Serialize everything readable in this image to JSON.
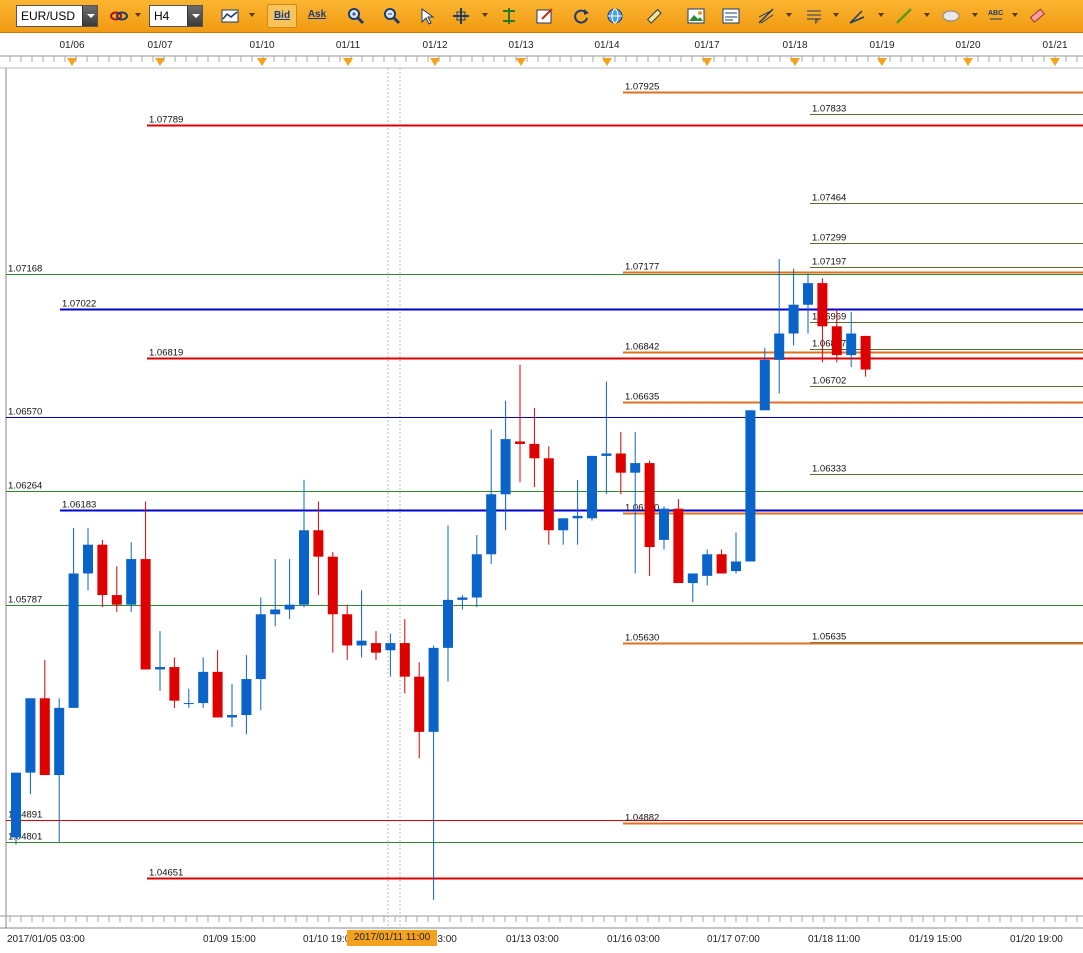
{
  "toolbar": {
    "symbol": "EUR/USD",
    "timeframe": "H4",
    "bid_label": "Bid",
    "ask_label": "Ask",
    "icons": [
      "link-icon",
      "indicator-icon",
      "zoom-in-icon",
      "zoom-out-icon",
      "cursor-icon",
      "crosshair-icon",
      "period-separator-icon",
      "edit-icon",
      "refresh-icon",
      "globe-icon",
      "ruler-icon",
      "screenshot-icon",
      "template-icon",
      "fibonacci-icon",
      "trendline-icon",
      "pen-icon",
      "line-icon",
      "ellipse-icon",
      "text-icon",
      "eraser-icon"
    ],
    "accent_color": "#f29a12"
  },
  "top_dates": [
    "01/06",
    "01/07",
    "01/10",
    "01/11",
    "01/12",
    "01/13",
    "01/14",
    "01/17",
    "01/18",
    "01/19",
    "01/20",
    "01/21"
  ],
  "bottom_dates": [
    "2017/01/05 03:00",
    "01/09 15:00",
    "01/10 19:00",
    "01/12 23:00",
    "01/13 03:00",
    "01/16 03:00",
    "01/17 07:00",
    "01/18 11:00",
    "01/19 15:00",
    "01/20 19:00"
  ],
  "highlight_time": "2017/01/11 11:00",
  "levels": [
    {
      "price": "1.07925",
      "color": "#e07020",
      "label_side": "mid"
    },
    {
      "price": "1.07833",
      "color": "#556b2f",
      "label_side": "right"
    },
    {
      "price": "1.07789",
      "color": "#dd0000",
      "label_side": "left"
    },
    {
      "price": "1.07464",
      "color": "#556b2f",
      "label_side": "right"
    },
    {
      "price": "1.07299",
      "color": "#556b2f",
      "label_side": "right"
    },
    {
      "price": "1.07197",
      "color": "#556b2f",
      "label_side": "right"
    },
    {
      "price": "1.07177",
      "color": "#e07020",
      "label_side": "mid"
    },
    {
      "price": "1.07168",
      "color": "#2e8b2e",
      "label_side": "edge"
    },
    {
      "price": "1.07022",
      "color": "#0000cc",
      "label_side": "left"
    },
    {
      "price": "1.06969",
      "color": "#556b2f",
      "label_side": "right"
    },
    {
      "price": "1.06857",
      "color": "#556b2f",
      "label_side": "right"
    },
    {
      "price": "1.06842",
      "color": "#e07020",
      "label_side": "mid"
    },
    {
      "price": "1.06819",
      "color": "#dd0000",
      "label_side": "left"
    },
    {
      "price": "1.06702",
      "color": "#556b2f",
      "label_side": "right"
    },
    {
      "price": "1.06635",
      "color": "#e07020",
      "label_side": "mid"
    },
    {
      "price": "1.06570",
      "color": "#0000cc",
      "label_side": "edge"
    },
    {
      "price": "1.06333",
      "color": "#556b2f",
      "label_side": "right"
    },
    {
      "price": "1.06264",
      "color": "#2e8b2e",
      "label_side": "edge"
    },
    {
      "price": "1.06183",
      "color": "#0000cc",
      "label_side": "left"
    },
    {
      "price": "1.06170",
      "color": "#e07020",
      "label_side": "mid"
    },
    {
      "price": "1.05787",
      "color": "#2e8b2e",
      "label_side": "edge"
    },
    {
      "price": "1.05635",
      "color": "#556b2f",
      "label_side": "right"
    },
    {
      "price": "1.05630",
      "color": "#e07020",
      "label_side": "mid"
    },
    {
      "price": "1.04891",
      "color": "#dd0000",
      "label_side": "edge"
    },
    {
      "price": "1.04882",
      "color": "#e07020",
      "label_side": "mid"
    },
    {
      "price": "1.04801",
      "color": "#2e8b2e",
      "label_side": "edge"
    },
    {
      "price": "1.04651",
      "color": "#dd0000",
      "label_side": "left"
    }
  ],
  "colors": {
    "bull": "#0a63c9",
    "bear": "#dd0000",
    "wick_bull": "#0a63c9",
    "wick_bear": "#dd0000"
  },
  "candles": [
    {
      "o": 1.0482,
      "h": 1.0503,
      "l": 1.0479,
      "c": 1.0509
    },
    {
      "o": 1.0509,
      "h": 1.052,
      "l": 1.05,
      "c": 1.054
    },
    {
      "o": 1.054,
      "h": 1.0556,
      "l": 1.0508,
      "c": 1.0508
    },
    {
      "o": 1.0508,
      "h": 1.054,
      "l": 1.048,
      "c": 1.0536
    },
    {
      "o": 1.0536,
      "h": 1.0611,
      "l": 1.0536,
      "c": 1.0592
    },
    {
      "o": 1.0592,
      "h": 1.0611,
      "l": 1.0585,
      "c": 1.0604
    },
    {
      "o": 1.0604,
      "h": 1.0606,
      "l": 1.0578,
      "c": 1.0583
    },
    {
      "o": 1.0583,
      "h": 1.0595,
      "l": 1.0576,
      "c": 1.0579
    },
    {
      "o": 1.0579,
      "h": 1.0605,
      "l": 1.0576,
      "c": 1.0598
    },
    {
      "o": 1.0598,
      "h": 1.0622,
      "l": 1.0552,
      "c": 1.0552
    },
    {
      "o": 1.0552,
      "h": 1.0568,
      "l": 1.0543,
      "c": 1.0553
    },
    {
      "o": 1.0553,
      "h": 1.0557,
      "l": 1.0536,
      "c": 1.0539
    },
    {
      "o": 1.0538,
      "h": 1.0544,
      "l": 1.0536,
      "c": 1.0538
    },
    {
      "o": 1.0538,
      "h": 1.0557,
      "l": 1.0536,
      "c": 1.0551
    },
    {
      "o": 1.0551,
      "h": 1.056,
      "l": 1.0532,
      "c": 1.0532
    },
    {
      "o": 1.0532,
      "h": 1.0546,
      "l": 1.0528,
      "c": 1.0533
    },
    {
      "o": 1.0533,
      "h": 1.0558,
      "l": 1.0525,
      "c": 1.0548
    },
    {
      "o": 1.0548,
      "h": 1.0582,
      "l": 1.0535,
      "c": 1.0575
    },
    {
      "o": 1.0575,
      "h": 1.0598,
      "l": 1.057,
      "c": 1.0577
    },
    {
      "o": 1.0577,
      "h": 1.0598,
      "l": 1.0573,
      "c": 1.0579
    },
    {
      "o": 1.0579,
      "h": 1.0631,
      "l": 1.0578,
      "c": 1.061
    },
    {
      "o": 1.061,
      "h": 1.0622,
      "l": 1.0583,
      "c": 1.0599
    },
    {
      "o": 1.0599,
      "h": 1.0601,
      "l": 1.0559,
      "c": 1.0575
    },
    {
      "o": 1.0575,
      "h": 1.0579,
      "l": 1.0556,
      "c": 1.0562
    },
    {
      "o": 1.0562,
      "h": 1.0585,
      "l": 1.0557,
      "c": 1.0564
    },
    {
      "o": 1.0563,
      "h": 1.0568,
      "l": 1.0556,
      "c": 1.0559
    },
    {
      "o": 1.056,
      "h": 1.0567,
      "l": 1.0549,
      "c": 1.0563
    },
    {
      "o": 1.0563,
      "h": 1.0573,
      "l": 1.0542,
      "c": 1.0549
    },
    {
      "o": 1.0549,
      "h": 1.0555,
      "l": 1.0515,
      "c": 1.0526
    },
    {
      "o": 1.0526,
      "h": 1.0562,
      "l": 1.0456,
      "c": 1.0561
    },
    {
      "o": 1.0561,
      "h": 1.0612,
      "l": 1.0547,
      "c": 1.0581
    },
    {
      "o": 1.0581,
      "h": 1.0583,
      "l": 1.0577,
      "c": 1.0582
    },
    {
      "o": 1.0582,
      "h": 1.0608,
      "l": 1.0578,
      "c": 1.06
    },
    {
      "o": 1.06,
      "h": 1.0652,
      "l": 1.0596,
      "c": 1.0625
    },
    {
      "o": 1.0625,
      "h": 1.0664,
      "l": 1.061,
      "c": 1.0648
    },
    {
      "o": 1.0647,
      "h": 1.0679,
      "l": 1.063,
      "c": 1.0646
    },
    {
      "o": 1.0646,
      "h": 1.0661,
      "l": 1.0628,
      "c": 1.064
    },
    {
      "o": 1.064,
      "h": 1.0645,
      "l": 1.0604,
      "c": 1.061
    },
    {
      "o": 1.061,
      "h": 1.0614,
      "l": 1.0604,
      "c": 1.0615
    },
    {
      "o": 1.0615,
      "h": 1.0631,
      "l": 1.0604,
      "c": 1.0616
    },
    {
      "o": 1.0615,
      "h": 1.0641,
      "l": 1.0614,
      "c": 1.0641
    },
    {
      "o": 1.0641,
      "h": 1.0672,
      "l": 1.0625,
      "c": 1.0642
    },
    {
      "o": 1.0642,
      "h": 1.0651,
      "l": 1.0625,
      "c": 1.0634
    },
    {
      "o": 1.0634,
      "h": 1.0651,
      "l": 1.0592,
      "c": 1.0638
    },
    {
      "o": 1.0638,
      "h": 1.0639,
      "l": 1.0591,
      "c": 1.0603
    },
    {
      "o": 1.0606,
      "h": 1.062,
      "l": 1.0602,
      "c": 1.0619
    },
    {
      "o": 1.0619,
      "h": 1.0623,
      "l": 1.0588,
      "c": 1.0588
    },
    {
      "o": 1.0588,
      "h": 1.0592,
      "l": 1.058,
      "c": 1.0592
    },
    {
      "o": 1.0591,
      "h": 1.0602,
      "l": 1.0587,
      "c": 1.06
    },
    {
      "o": 1.06,
      "h": 1.0602,
      "l": 1.0592,
      "c": 1.0592
    },
    {
      "o": 1.0593,
      "h": 1.0609,
      "l": 1.0592,
      "c": 1.0597
    },
    {
      "o": 1.0597,
      "h": 1.066,
      "l": 1.0597,
      "c": 1.066
    },
    {
      "o": 1.066,
      "h": 1.0686,
      "l": 1.066,
      "c": 1.0681
    },
    {
      "o": 1.0681,
      "h": 1.0723,
      "l": 1.0667,
      "c": 1.0692
    },
    {
      "o": 1.0692,
      "h": 1.0719,
      "l": 1.0687,
      "c": 1.0704
    },
    {
      "o": 1.0704,
      "h": 1.0717,
      "l": 1.0692,
      "c": 1.0713
    },
    {
      "o": 1.0713,
      "h": 1.0715,
      "l": 1.068,
      "c": 1.0695
    },
    {
      "o": 1.0695,
      "h": 1.0702,
      "l": 1.068,
      "c": 1.0683
    },
    {
      "o": 1.0683,
      "h": 1.0701,
      "l": 1.0678,
      "c": 1.0692
    },
    {
      "o": 1.0691,
      "h": 1.0691,
      "l": 1.0674,
      "c": 1.0677
    }
  ]
}
